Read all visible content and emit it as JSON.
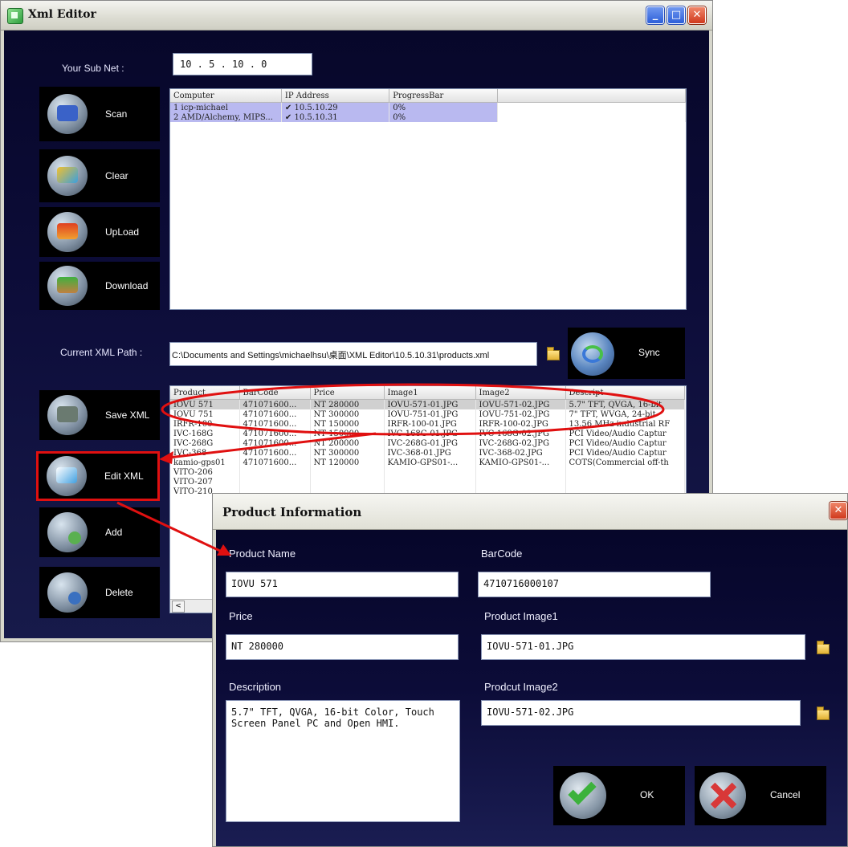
{
  "main_window": {
    "title": "Xml Editor",
    "minimize": "_",
    "maximize": "□",
    "close": "✕",
    "subnet_label": "Your Sub Net :",
    "subnet_value": "10 . 5 . 10 . 0",
    "computers_table": {
      "headers": [
        "Computer",
        "IP Address",
        "ProgressBar"
      ],
      "rows": [
        {
          "computer": "1 icp-michael",
          "checked": true,
          "ip": "10.5.10.29",
          "progress": "0%"
        },
        {
          "computer": "2 AMD/Alchemy, MIPS...",
          "checked": true,
          "ip": "10.5.10.31",
          "progress": "0%"
        }
      ]
    },
    "buttons": {
      "scan": "Scan",
      "clear": "Clear",
      "upload": "UpLoad",
      "download": "Download",
      "save_xml": "Save XML",
      "edit_xml": "Edit XML",
      "add": "Add",
      "delete": "Delete",
      "sync": "Sync"
    },
    "xml_path_label": "Current XML Path :",
    "xml_path_value": "C:\\Documents and Settings\\michaelhsu\\桌面\\XML Editor\\10.5.10.31\\products.xml",
    "products_table": {
      "headers": [
        "Product",
        "BarCode",
        "Price",
        "Image1",
        "Image2",
        "Descript"
      ],
      "rows": [
        [
          "IOVU 571",
          "471071600...",
          "NT 280000",
          "IOVU-571-01.JPG",
          "IOVU-571-02.JPG",
          "5.7\" TFT, QVGA, 16-bit"
        ],
        [
          "IOVU 751",
          "471071600...",
          "NT 300000",
          "IOVU-751-01.JPG",
          "IOVU-751-02.JPG",
          "7\" TFT, WVGA, 24-bit"
        ],
        [
          "IRFR-100",
          "471071600...",
          "NT 150000",
          "IRFR-100-01.JPG",
          "IRFR-100-02.JPG",
          "13.56 MHz industrial RF"
        ],
        [
          "IVC-168G",
          "471071600...",
          "NT 150000",
          "IVC-168G-01.JPG",
          "IVC-168G-02.JPG",
          "PCI Video/Audio Captur"
        ],
        [
          "IVC-268G",
          "471071600...",
          "NT 200000",
          "IVC-268G-01.JPG",
          "IVC-268G-02.JPG",
          "PCI Video/Audio Captur"
        ],
        [
          "IVC-368",
          "471071600...",
          "NT 300000",
          "IVC-368-01.JPG",
          "IVC-368-02.JPG",
          "PCI Video/Audio Captur"
        ],
        [
          "kamio-gps01",
          "471071600...",
          "NT 120000",
          "KAMIO-GPS01-...",
          "KAMIO-GPS01-...",
          "COTS(Commercial off-th"
        ],
        [
          "VITO-206",
          "",
          "",
          "",
          "",
          ""
        ],
        [
          "VITO-207",
          "",
          "",
          "",
          "",
          ""
        ],
        [
          "VITO-210",
          "",
          "",
          "",
          "",
          ""
        ]
      ]
    },
    "scroll_left": "<"
  },
  "dialog": {
    "title": "Product Information",
    "close": "✕",
    "product_name_label": "Product Name",
    "product_name_value": "IOVU 571",
    "barcode_label": "BarCode",
    "barcode_value": "4710716000107",
    "price_label": "Price",
    "price_value": "NT 280000",
    "image1_label": "Product Image1",
    "image1_value": "IOVU-571-01.JPG",
    "description_label": "Description",
    "description_value": "5.7\" TFT, QVGA, 16-bit Color, Touch Screen Panel PC and Open HMI.",
    "image2_label": "Prodcut Image2",
    "image2_value": "IOVU-571-02.JPG",
    "ok_label": "OK",
    "cancel_label": "Cancel"
  },
  "colors": {
    "annotation": "#e01010",
    "selection": "#b9b9f0",
    "panel_dark": "#0d0d3a"
  },
  "icons": [
    "app-icon",
    "scan-icon",
    "clear-icon",
    "upload-icon",
    "download-icon",
    "folder-icon",
    "sync-icon",
    "save-icon",
    "edit-icon",
    "add-icon",
    "delete-icon",
    "ok-check-icon",
    "cancel-x-icon",
    "close-icon",
    "checkbox-icon"
  ]
}
